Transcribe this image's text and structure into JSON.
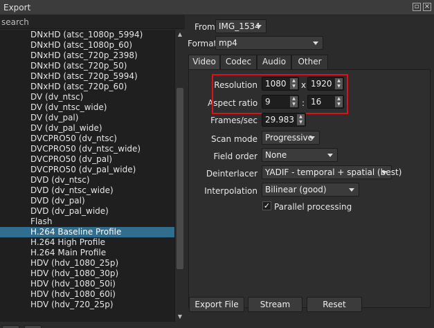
{
  "window": {
    "title": "Export"
  },
  "search": {
    "placeholder": "search"
  },
  "presets": [
    "DNxHD (atsc_1080p_5994)",
    "DNxHD (atsc_1080p_60)",
    "DNxHD (atsc_720p_2398)",
    "DNxHD (atsc_720p_50)",
    "DNxHD (atsc_720p_5994)",
    "DNxHD (atsc_720p_60)",
    "DV (dv_ntsc)",
    "DV (dv_ntsc_wide)",
    "DV (dv_pal)",
    "DV (dv_pal_wide)",
    "DVCPRO50 (dv_ntsc)",
    "DVCPRO50 (dv_ntsc_wide)",
    "DVCPRO50 (dv_pal)",
    "DVCPRO50 (dv_pal_wide)",
    "DVD (dv_ntsc)",
    "DVD (dv_ntsc_wide)",
    "DVD (dv_pal)",
    "DVD (dv_pal_wide)",
    "Flash",
    "H.264 Baseline Profile",
    "H.264 High Profile",
    "H.264 Main Profile",
    "HDV (hdv_1080_25p)",
    "HDV (hdv_1080_30p)",
    "HDV (hdv_1080_50i)",
    "HDV (hdv_1080_60i)",
    "HDV (hdv_720_25p)"
  ],
  "selected_preset": "H.264 Baseline Profile",
  "list_buttons": {
    "add": "+",
    "remove": "−"
  },
  "from": {
    "label": "From",
    "value": "IMG_1534"
  },
  "format": {
    "label": "Format",
    "value": "mp4"
  },
  "tabs": [
    "Video",
    "Codec",
    "Audio",
    "Other"
  ],
  "active_tab": "Video",
  "video": {
    "resolution": {
      "label": "Resolution",
      "width": "1080",
      "separator": "x",
      "height": "1920"
    },
    "aspect_ratio": {
      "label": "Aspect ratio",
      "num": "9",
      "separator": ":",
      "den": "16"
    },
    "frames_per_sec": {
      "label": "Frames/sec",
      "value": "29.983"
    },
    "scan_mode": {
      "label": "Scan mode",
      "value": "Progressive"
    },
    "field_order": {
      "label": "Field order",
      "value": "None"
    },
    "deinterlacer": {
      "label": "Deinterlacer",
      "value": "YADIF - temporal + spatial (best)"
    },
    "interpolation": {
      "label": "Interpolation",
      "value": "Bilinear (good)"
    },
    "parallel": {
      "label": "Parallel processing",
      "checked": true,
      "check_glyph": "✓"
    }
  },
  "actions": {
    "export": "Export File",
    "stream": "Stream",
    "reset": "Reset"
  },
  "colors": {
    "highlight": "#e0101a",
    "selection": "#2f6e8e"
  }
}
